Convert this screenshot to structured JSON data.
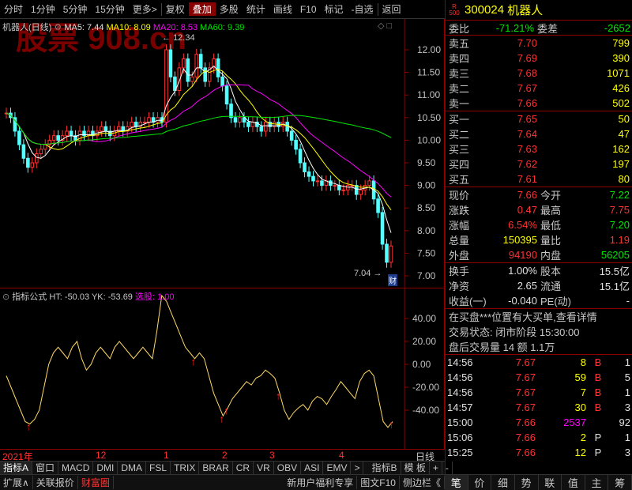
{
  "toolbar": {
    "items": [
      "分时",
      "1分钟",
      "5分钟",
      "15分钟",
      "更多>",
      "复权",
      "叠加",
      "多股",
      "统计",
      "画线",
      "F10",
      "标记",
      "-自选",
      "返回"
    ],
    "active_index": 6
  },
  "main_chart": {
    "title": "机器人(日线)",
    "ma5": "MA5: 7.44",
    "ma10": "MA10: 8.09",
    "ma20": "MA20: 8.53",
    "ma60": "MA60: 9.39",
    "high_marker": "12.34",
    "low_marker": "7.04",
    "cai_badge": "财",
    "y_ticks": [
      "12.00",
      "11.50",
      "11.00",
      "10.50",
      "10.00",
      "9.50",
      "9.00",
      "8.50",
      "8.00",
      "7.50",
      "7.00"
    ],
    "watermark": "股票 908.cn"
  },
  "indicator": {
    "title": "指标公式",
    "ht": "HT: -50.03",
    "yk": "YK: -53.69",
    "xg": "选股: 1.00",
    "y_ticks": [
      "40.00",
      "20.00",
      "0.00",
      "-20.00",
      "-40.00"
    ]
  },
  "x_axis": {
    "labels": [
      "2021年",
      "12",
      "1",
      "2",
      "3",
      "4"
    ],
    "period": "日线"
  },
  "tabs1": [
    "指标A",
    "窗口",
    "MACD",
    "DMI",
    "DMA",
    "FSL",
    "TRIX",
    "BRAR",
    "CR",
    "VR",
    "OBV",
    "ASI",
    "EMV",
    ">",
    "指标B",
    "模 板",
    "+",
    "-"
  ],
  "tabs2": [
    "扩展∧",
    "关联报价",
    "财富圈",
    "新用户福利专享",
    "图文F10",
    "侧边栏《"
  ],
  "stock": {
    "badge_top": "R",
    "badge_bottom": "500",
    "code": "300024",
    "name": "机器人",
    "weibi_label": "委比",
    "weibi_value": "-71.21%",
    "weicha_label": "委差",
    "weicha_value": "-2652"
  },
  "sell": [
    {
      "label": "卖五",
      "price": "7.70",
      "vol": "799"
    },
    {
      "label": "卖四",
      "price": "7.69",
      "vol": "390"
    },
    {
      "label": "卖三",
      "price": "7.68",
      "vol": "1071"
    },
    {
      "label": "卖二",
      "price": "7.67",
      "vol": "426"
    },
    {
      "label": "卖一",
      "price": "7.66",
      "vol": "502"
    }
  ],
  "buy": [
    {
      "label": "买一",
      "price": "7.65",
      "vol": "50"
    },
    {
      "label": "买二",
      "price": "7.64",
      "vol": "47"
    },
    {
      "label": "买三",
      "price": "7.63",
      "vol": "162"
    },
    {
      "label": "买四",
      "price": "7.62",
      "vol": "197"
    },
    {
      "label": "买五",
      "price": "7.61",
      "vol": "80"
    }
  ],
  "quote": [
    {
      "l1": "现价",
      "v1": "7.66",
      "c1": "red",
      "l2": "今开",
      "v2": "7.22",
      "c2": "green"
    },
    {
      "l1": "涨跌",
      "v1": "0.47",
      "c1": "red",
      "l2": "最高",
      "v2": "7.75",
      "c2": "red"
    },
    {
      "l1": "涨幅",
      "v1": "6.54%",
      "c1": "red",
      "l2": "最低",
      "v2": "7.20",
      "c2": "green"
    },
    {
      "l1": "总量",
      "v1": "150395",
      "c1": "yellow",
      "l2": "量比",
      "v2": "1.19",
      "c2": "red"
    },
    {
      "l1": "外盘",
      "v1": "94190",
      "c1": "red",
      "l2": "内盘",
      "v2": "56205",
      "c2": "green"
    }
  ],
  "fin": [
    {
      "l1": "换手",
      "v1": "1.00%",
      "l2": "股本",
      "v2": "15.5亿"
    },
    {
      "l1": "净资",
      "v1": "2.65",
      "l2": "流通",
      "v2": "15.1亿"
    },
    {
      "l1": "收益(一)",
      "v1": "-0.040",
      "l2": "PE(动)",
      "v2": "-"
    }
  ],
  "notice": "在买盘***位置有大买单,查看详情",
  "status_line": "交易状态: 闭市阶段 15:30:00",
  "after_hours": "盘后交易量 14 额 1.1万",
  "ticks": [
    {
      "time": "14:56",
      "price": "7.67",
      "vol": "8",
      "bs": "B",
      "n": "1"
    },
    {
      "time": "14:56",
      "price": "7.67",
      "vol": "59",
      "bs": "B",
      "n": "5"
    },
    {
      "time": "14:56",
      "price": "7.67",
      "vol": "7",
      "bs": "B",
      "n": "1"
    },
    {
      "time": "14:57",
      "price": "7.67",
      "vol": "30",
      "bs": "B",
      "n": "3"
    },
    {
      "time": "15:00",
      "price": "7.66",
      "vol": "2537",
      "bs": "",
      "n": "92"
    },
    {
      "time": "15:06",
      "price": "7.66",
      "vol": "2",
      "bs": "P",
      "n": "1"
    },
    {
      "time": "15:25",
      "price": "7.66",
      "vol": "12",
      "bs": "P",
      "n": "3"
    }
  ],
  "bottom_tabs": [
    "笔",
    "价",
    "细",
    "势",
    "联",
    "值",
    "主",
    "筹"
  ]
}
